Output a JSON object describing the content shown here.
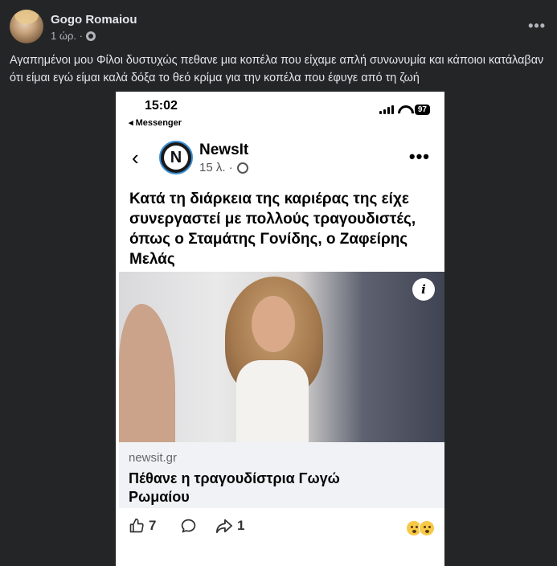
{
  "post": {
    "author": "Gogo Romaiou",
    "time": "1 ώρ. ·",
    "more": "•••",
    "text": "Αγαπημένοι μου Φίλοι δυστυχώς πεθανε μια κοπέλα που είχαμε απλή συνωνυμία και κάποιοι κατάλαβαν ότι είμαι εγώ είμαι καλά δόξα το θεό κρίμα για την κοπέλα που έφυγε από τη ζωή"
  },
  "screenshot": {
    "status": {
      "time": "15:02",
      "back_app": "◂ Messenger",
      "battery": "97"
    },
    "page": {
      "back": "‹",
      "logo_letter": "N",
      "name": "NewsIt",
      "time": "15 λ. ·",
      "more": "•••"
    },
    "headline": "Κατά τη διάρκεια της καριέρας της είχε συνεργαστεί με πολλούς τραγουδιστές, όπως ο Σταμάτης Γονίδης, ο Ζαφείρης Μελάς",
    "info_icon": "i",
    "link": {
      "domain": "newsit.gr",
      "title": "Πέθανε η τραγουδίστρια Γωγώ Ρωμαίου"
    },
    "actions": {
      "like_count": "7",
      "share_count": "1"
    }
  },
  "colors": {
    "dark_bg": "#242526",
    "text_light": "#e4e6eb",
    "text_muted": "#b0b3b8",
    "card_bg": "#f0f2f5"
  },
  "icons": [
    "globe-icon",
    "more-icon",
    "chevron-left-icon",
    "signal-icon",
    "wifi-icon",
    "battery-icon",
    "info-icon",
    "like-icon",
    "comment-icon",
    "share-icon",
    "sad-reaction-icon",
    "wow-reaction-icon"
  ]
}
